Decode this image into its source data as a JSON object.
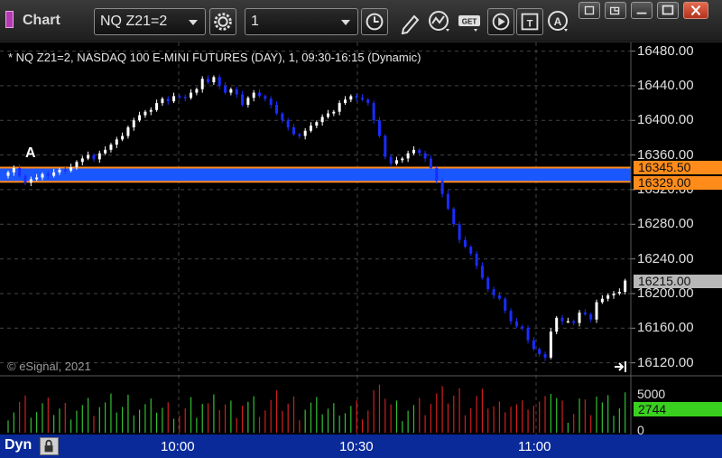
{
  "window": {
    "title": "Chart",
    "symbol_field": "NQ Z21=2",
    "interval_field": "1"
  },
  "toolbar": {
    "icons": [
      "settings-gear-icon",
      "clock-icon",
      "pencil-draw-icon",
      "study-wave-icon",
      "get-data-icon",
      "play-icon",
      "text-tool-icon",
      "alert-icon"
    ],
    "window_buttons": [
      "restore-icon",
      "popout-icon",
      "maximize-icon",
      "close-icon"
    ]
  },
  "chart": {
    "header_text": "* NQ Z21=2, NASDAQ 100 E-MINI FUTURES (DAY), 1, 09:30-16:15 (Dynamic)",
    "copyright": "© eSignal, 2021",
    "marker_label": "A",
    "price_axis": [
      "16480.00",
      "16440.00",
      "16400.00",
      "16360.00",
      "16320.00",
      "16280.00",
      "16240.00",
      "16200.00",
      "16160.00",
      "16120.00"
    ],
    "price_tags": {
      "upper": "16345.50",
      "lower": "16329.00",
      "last": "16215.00"
    },
    "volume_axis": [
      "5000",
      "0"
    ],
    "volume_last": "2744",
    "mode_label": "Dyn",
    "time_axis": [
      "10:00",
      "10:30",
      "11:00"
    ],
    "colors": {
      "band": "#1b57ff",
      "band_border": "#ff8a1a",
      "up_candle": "#ffffff",
      "down_candle": "#1a2cff",
      "vol_up": "#33c033",
      "vol_down": "#d02020",
      "volume_tag": "#39d01f",
      "last_tag": "#b8b8b8",
      "orange_tag": "#ff8c1a"
    }
  },
  "chart_data": {
    "type": "candlestick",
    "ylim": [
      16105,
      16490
    ],
    "y_ticks": [
      16120,
      16160,
      16200,
      16240,
      16280,
      16320,
      16360,
      16400,
      16440,
      16480
    ],
    "band": [
      16329.0,
      16345.5
    ],
    "last_price": 16215.0,
    "volume_ylim": [
      0,
      6000
    ],
    "x_labels": [
      "10:00",
      "10:30",
      "11:00"
    ],
    "closes": [
      16340,
      16345,
      16336,
      16328,
      16332,
      16334,
      16338,
      16336,
      16340,
      16343,
      16342,
      16346,
      16352,
      16356,
      16360,
      16355,
      16362,
      16366,
      16372,
      16378,
      16382,
      16392,
      16400,
      16406,
      16410,
      16412,
      16420,
      16425,
      16422,
      16428,
      16427,
      16426,
      16432,
      16436,
      16448,
      16444,
      16450,
      16440,
      16432,
      16436,
      16430,
      16418,
      16426,
      16432,
      16428,
      16425,
      16418,
      16408,
      16400,
      16392,
      16384,
      16382,
      16388,
      16394,
      16398,
      16404,
      16408,
      16410,
      16420,
      16424,
      16428,
      16426,
      16424,
      16420,
      16400,
      16382,
      16358,
      16350,
      16354,
      16356,
      16362,
      16366,
      16362,
      16356,
      16345,
      16330,
      16315,
      16298,
      16280,
      16262,
      16254,
      16246,
      16232,
      16218,
      16205,
      16198,
      16194,
      16180,
      16168,
      16162,
      16160,
      16146,
      16136,
      16130,
      16126,
      16156,
      16172,
      16168,
      16168,
      16166,
      16178,
      16176,
      16170,
      16190,
      16194,
      16198,
      16200,
      16202,
      16215
    ]
  }
}
